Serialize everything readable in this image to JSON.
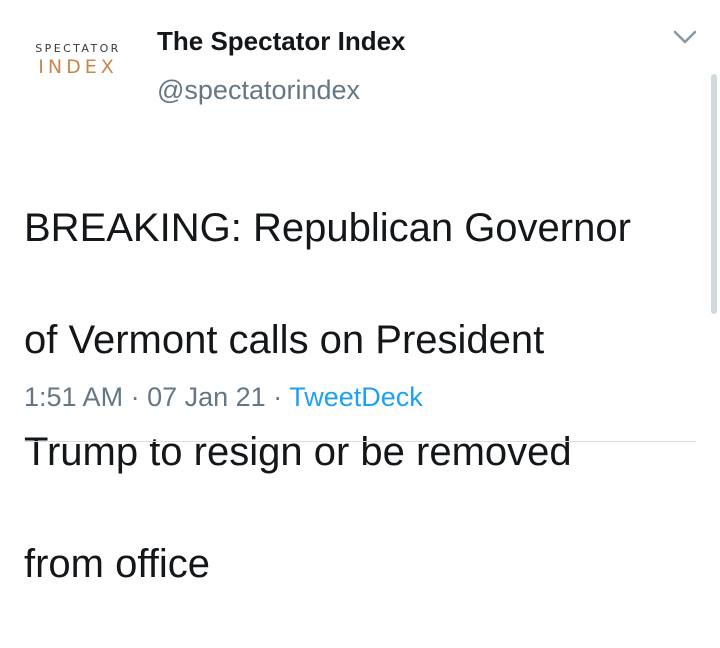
{
  "account": {
    "avatar_top": "SPECTATOR",
    "avatar_bottom": "INDEX",
    "display_name": "The Spectator Index",
    "handle": "@spectatorindex"
  },
  "tweet": {
    "text_lines": [
      "BREAKING: Republican Governor",
      "of Vermont calls on President",
      "Trump to resign or be removed",
      "from office"
    ],
    "time": "1:51 AM",
    "separator": "·",
    "date": "07 Jan 21",
    "source": "TweetDeck"
  },
  "icons": {
    "menu": "chevron-down-icon"
  },
  "colors": {
    "text": "#14171a",
    "secondary": "#657786",
    "link": "#1da1f2",
    "logo_accent": "#c8874a"
  }
}
